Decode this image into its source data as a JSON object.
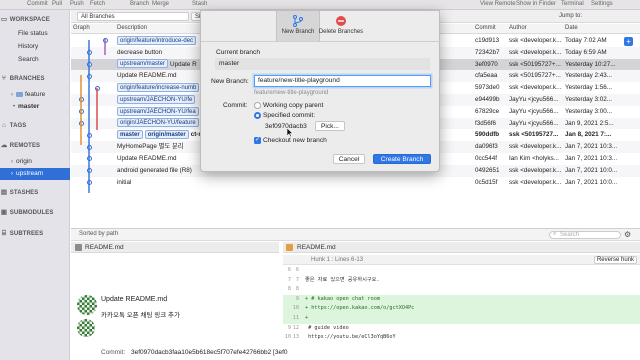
{
  "toolbar": {
    "items": [
      "Commit",
      "Pull",
      "Push",
      "Fetch",
      "Branch",
      "Merge",
      "Stash",
      "View Remote",
      "Show in Finder",
      "Terminal",
      "Settings"
    ]
  },
  "sidebar": {
    "workspace": "WORKSPACE",
    "file_status": "File status",
    "history": "History",
    "search": "Search",
    "branches": "BRANCHES",
    "feature": "feature",
    "master": "master",
    "tags": "TAGS",
    "remotes": "REMOTES",
    "origin": "origin",
    "upstream": "upstream",
    "stashes": "STASHES",
    "submodules": "SUBMODULES",
    "subtrees": "SUBTREES"
  },
  "filters": {
    "branches": "All Branches",
    "show": "Sho",
    "jump_to": "Jump to:"
  },
  "columns": {
    "graph": "Graph",
    "description": "Description",
    "commit": "Commit",
    "author": "Author",
    "date": "Date"
  },
  "commits": [
    {
      "tags": [
        "origin/feature/introduce-dec"
      ],
      "desc": "",
      "commit": "c19d913",
      "author": "ssk <developer.k...",
      "date": "Today 7:02 AM"
    },
    {
      "tags": [],
      "desc": "decrease button",
      "commit": "72342b7",
      "author": "ssk <developer.k...",
      "date": "Today 6:59 AM"
    },
    {
      "tags": [
        "upstream/master"
      ],
      "desc": "Update R",
      "commit": "3ef0970",
      "author": "ssk <50195727+...",
      "date": "Yesterday 10:27..."
    },
    {
      "tags": [],
      "desc": "Update README.md",
      "commit": "cfa5eaa",
      "author": "ssk <50195727+...",
      "date": "Yesterday 2:43..."
    },
    {
      "tags": [
        "origin/feature/increase-numb"
      ],
      "desc": "",
      "commit": "5973de0",
      "author": "ssk <developer.k...",
      "date": "Yesterday 1:56..."
    },
    {
      "tags": [
        "upstream/JAECHON-YU/fe"
      ],
      "desc": "",
      "commit": "e94499b",
      "author": "JayYu <jcyu566...",
      "date": "Yesterday 3:02..."
    },
    {
      "tags": [
        "upstream/JAECHON-YU/fea"
      ],
      "desc": "",
      "commit": "67829ce",
      "author": "JayYu <jcyu566...",
      "date": "Yesterday 3:00..."
    },
    {
      "tags": [
        "origin/JAECHON-YU/feature"
      ],
      "desc": "",
      "commit": "f3d56f6",
      "author": "JayYu <jcyu566...",
      "date": "Jan 9, 2021 2:5..."
    },
    {
      "tags": [
        "master",
        "origin/master"
      ],
      "desc": "ct-my-h...",
      "commit": "590ddfb",
      "author": "ssk <50195727...",
      "date": "Jan 8, 2021 7:..."
    },
    {
      "tags": [],
      "desc": "MyHomePage 별도 분리",
      "commit": "da096f3",
      "author": "ssk <developer.k...",
      "date": "Jan 7, 2021 10:3..."
    },
    {
      "tags": [],
      "desc": "Update README.md",
      "commit": "0cc544f",
      "author": "Ian Kim <holyks...",
      "date": "Jan 7, 2021 10:3..."
    },
    {
      "tags": [],
      "desc": "android generated file (R8)",
      "commit": "0492651",
      "author": "ssk <developer.k...",
      "date": "Jan 7, 2021 10:0..."
    },
    {
      "tags": [],
      "desc": "initial",
      "commit": "0c5d15f",
      "author": "ssk <developer.k...",
      "date": "Jan 7, 2021 10:0..."
    }
  ],
  "bottom": {
    "sort": "Sorted by path",
    "search_placeholder": "Search",
    "file_left": "README.md",
    "file_right": "README.md",
    "hunk": "Hunk 1 : Lines 6-13",
    "reverse_hunk": "Reverse hunk",
    "commit_title": "Update README.md",
    "commit_sub": "카카오톡 오픈 채팅 링크 추가",
    "commit_label": "Commit:",
    "commit_hash": "3ef0970dacb3faa10e5b618ec5f707efe42766bb2 [3ef0"
  },
  "diff": [
    {
      "old": "6",
      "new": "6",
      "text": "",
      "add": false
    },
    {
      "old": "7",
      "new": "7",
      "text": "좋은 자료 있으면 공유하시구요.",
      "add": false
    },
    {
      "old": "8",
      "new": "8",
      "text": "",
      "add": false
    },
    {
      "old": "",
      "new": "9",
      "text": "+ # kakao open chat room",
      "add": true
    },
    {
      "old": "",
      "new": "10",
      "text": "+ https://open.kakao.com/o/gctXO4Pc",
      "add": true
    },
    {
      "old": "",
      "new": "11",
      "text": "+",
      "add": true
    },
    {
      "old": "9",
      "new": "12",
      "text": "  # guide video",
      "add": false
    },
    {
      "old": "10",
      "new": "13",
      "text": "  https://youtu.be/eCl3oYqB6oY",
      "add": false
    }
  ],
  "dialog": {
    "tab_new": "New Branch",
    "tab_delete": "Delete Branches",
    "current_label": "Current branch",
    "current_value": "master",
    "new_label": "New Branch:",
    "new_value": "feature/new-title-playground",
    "hint": "feature/new-title-playground",
    "commit_label": "Commit:",
    "opt_working": "Working copy parent",
    "opt_specified": "Specified commit:",
    "specified_hash": "3ef0970dacb3",
    "pick_label": "Pick...",
    "checkout_label": "Checkout new branch",
    "cancel": "Cancel",
    "create": "Create Branch"
  },
  "colors": {
    "accent": "#2f76e6",
    "sidebar_sel": "#2f6fd6"
  }
}
